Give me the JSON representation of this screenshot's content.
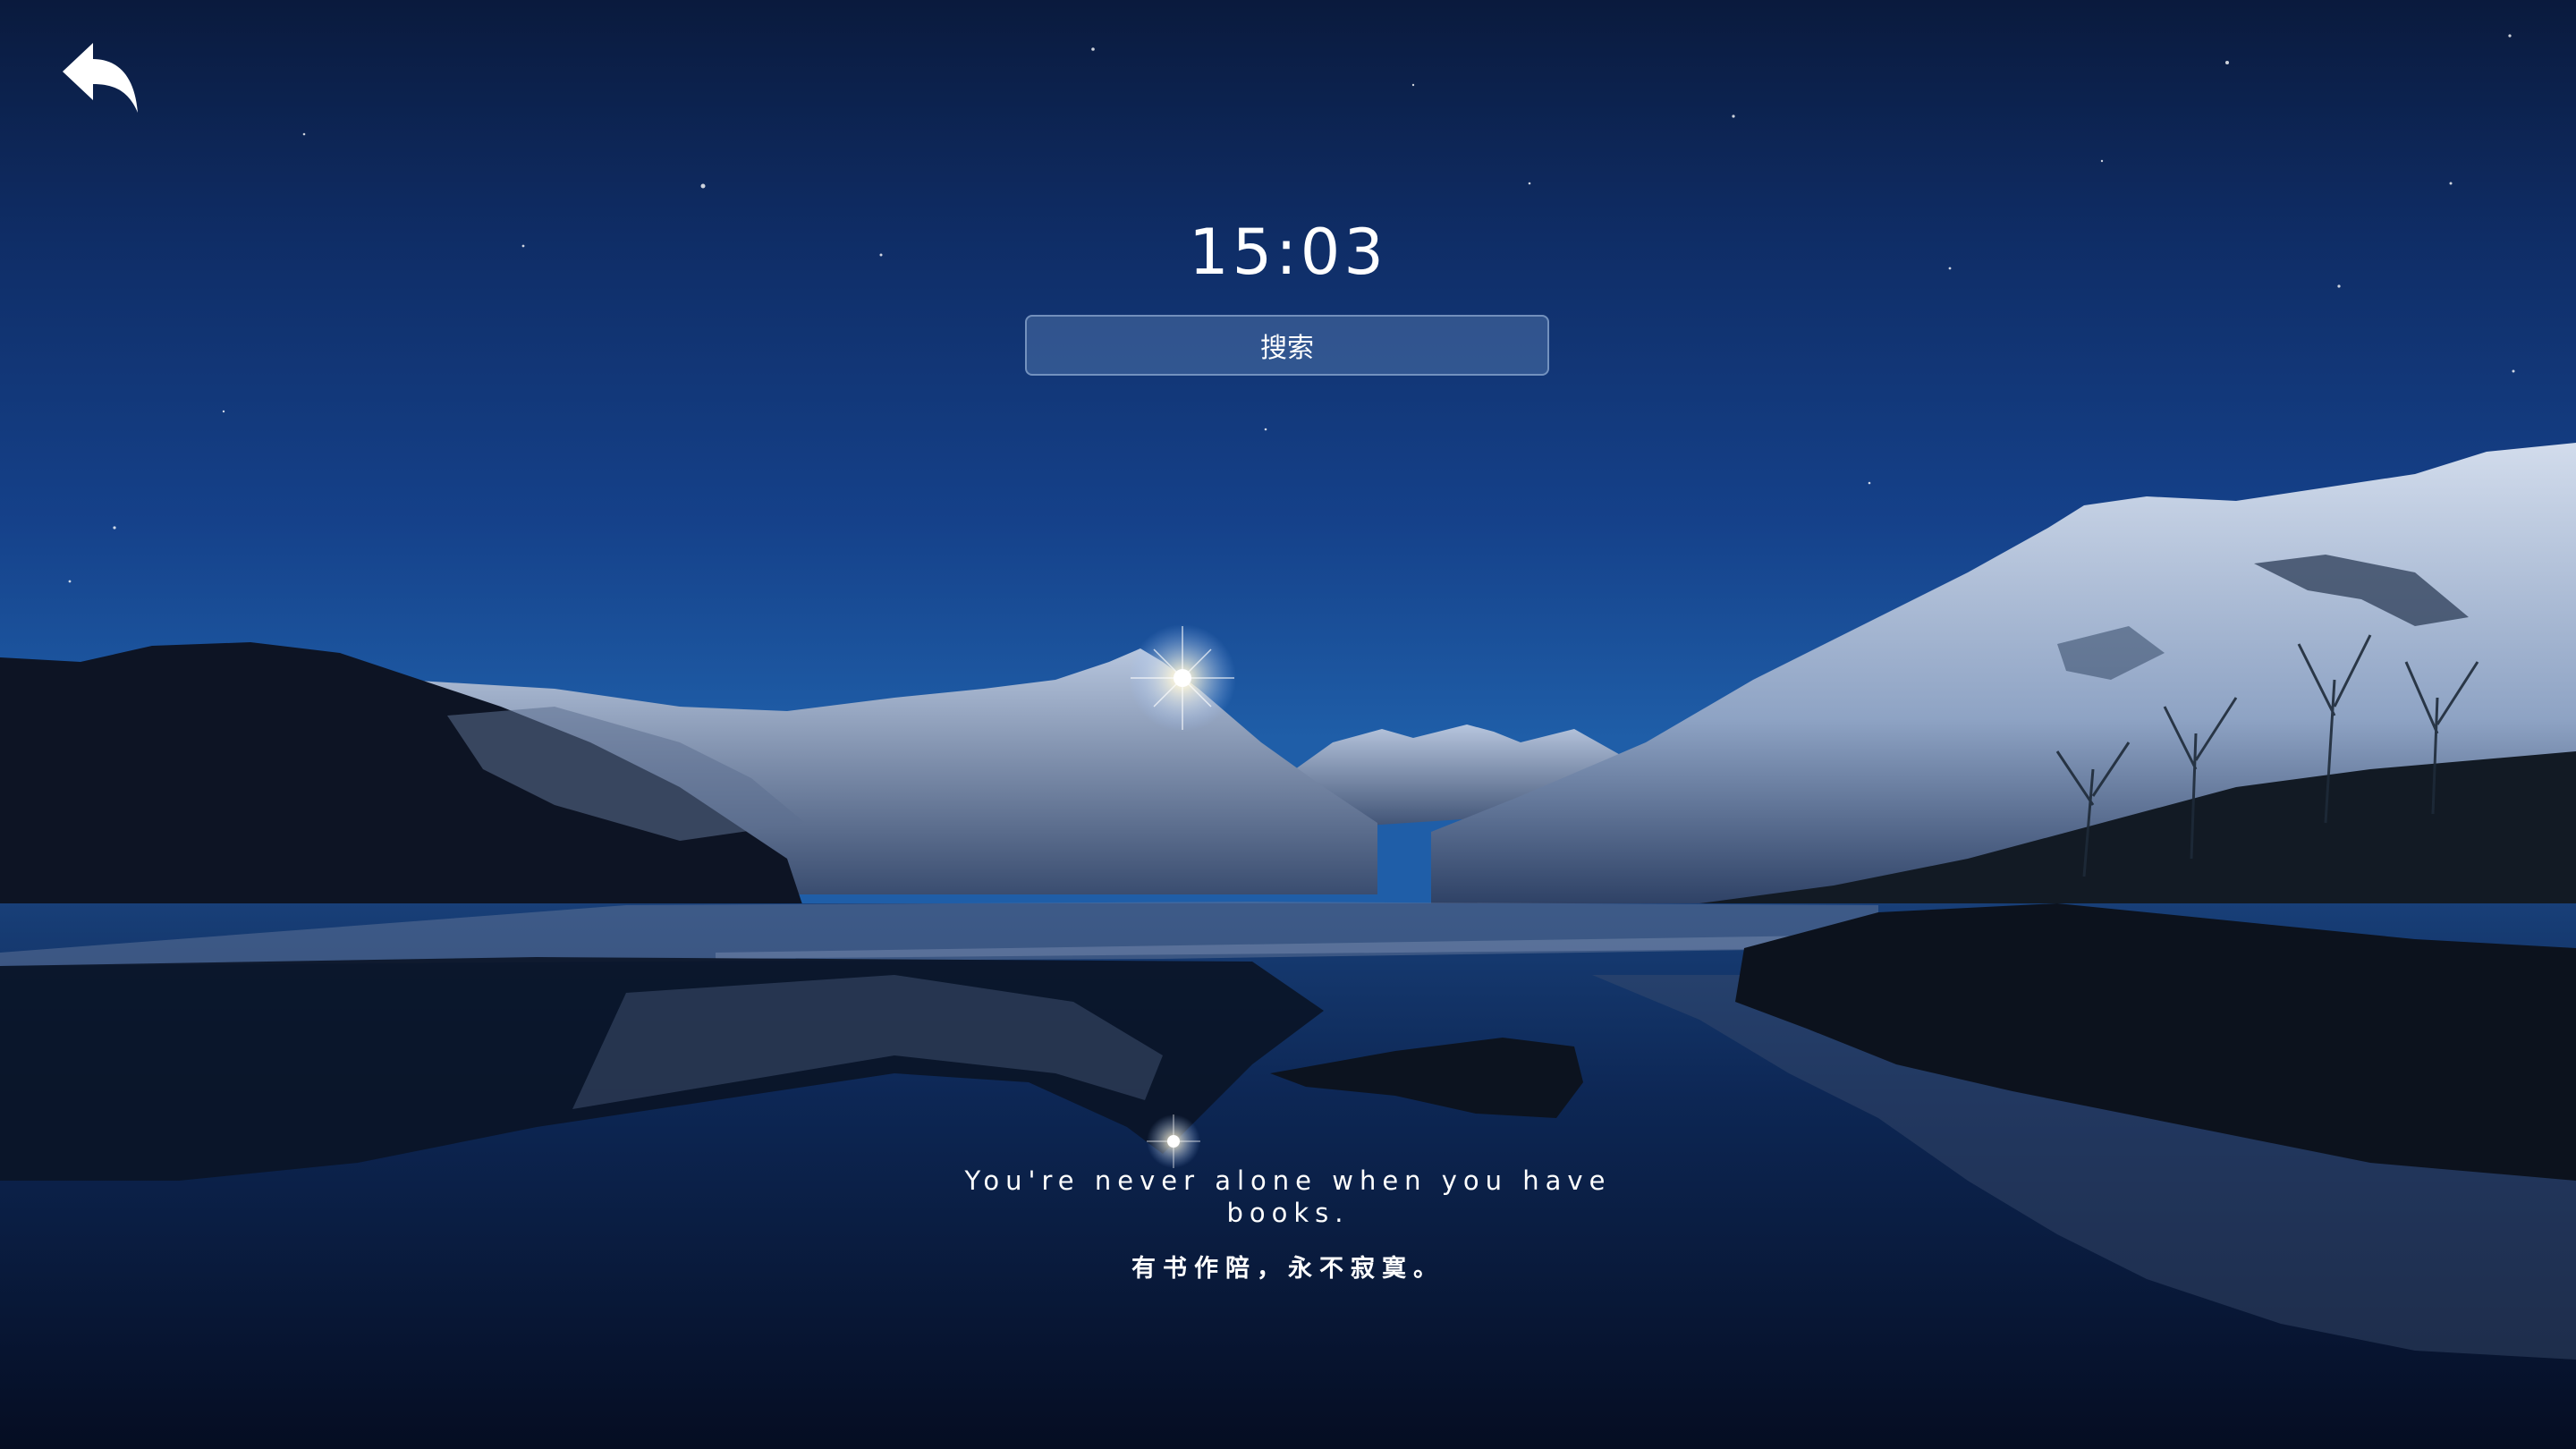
{
  "colors": {
    "sky_top": "#0a1a3d",
    "sky_mid": "#15418a",
    "sky_horizon": "#1f5ea8",
    "text": "#ffffff"
  },
  "header": {
    "back_icon": "undo-arrow-icon"
  },
  "clock": {
    "time": "15:03"
  },
  "search": {
    "label": "搜索"
  },
  "quote": {
    "english": "You're never alone when you have books.",
    "chinese": "有书作陪，永不寂寞。"
  }
}
